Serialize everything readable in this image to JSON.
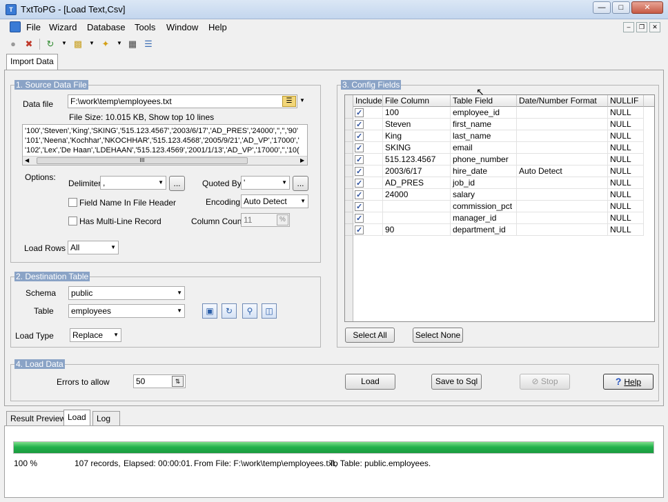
{
  "window": {
    "title": "TxtToPG - [Load Text,Csv]",
    "minimize": "0",
    "maximize": "1",
    "close": "r"
  },
  "menu": [
    "File",
    "Wizard",
    "Database",
    "Tools",
    "Window",
    "Help"
  ],
  "tabs_top": [
    "Import Data"
  ],
  "source": {
    "group_title": "1. Source Data File",
    "data_file_label": "Data file",
    "data_file_value": "F:\\work\\temp\\employees.txt",
    "file_info": "File Size: 10.015 KB,  Show top 10 lines",
    "preview_lines": [
      "'100','Steven','King','SKING','515.123.4567','2003/6/17','AD_PRES','24000','','','90'",
      "'101','Neena','Kochhar','NKOCHHAR','515.123.4568','2005/9/21','AD_VP','17000','",
      "'102','Lex','De Haan','LDEHAAN','515.123.4569','2001/1/13','AD_VP','17000','','10("
    ],
    "scroll_mark": "III",
    "options_label": "Options:",
    "delimiter_label": "Delimiter",
    "delimiter_value": ",",
    "quoted_by_label": "Quoted By",
    "quoted_by_value": "'",
    "browse_label": "...",
    "field_name_header_label": "Field Name In File Header",
    "multiline_label": "Has Multi-Line Record",
    "encoding_label": "Encoding",
    "encoding_value": "Auto Detect",
    "column_count_label": "Column Count",
    "column_count_value": "11",
    "load_rows_label": "Load Rows",
    "load_rows_value": "All"
  },
  "destination": {
    "group_title": "2. Destination Table",
    "schema_label": "Schema",
    "schema_value": "public",
    "table_label": "Table",
    "table_value": "employees",
    "load_type_label": "Load Type",
    "load_type_value": "Replace"
  },
  "config": {
    "group_title": "3. Config Fields",
    "columns": [
      "Include",
      "File Column",
      "Table Field",
      "Date/Number Format",
      "NULLIF"
    ],
    "rows": [
      {
        "include": true,
        "file_column": "100",
        "table_field": "employee_id",
        "format": "",
        "nullif": "NULL"
      },
      {
        "include": true,
        "file_column": "Steven",
        "table_field": "first_name",
        "format": "",
        "nullif": "NULL"
      },
      {
        "include": true,
        "file_column": "King",
        "table_field": "last_name",
        "format": "",
        "nullif": "NULL"
      },
      {
        "include": true,
        "file_column": "SKING",
        "table_field": "email",
        "format": "",
        "nullif": "NULL"
      },
      {
        "include": true,
        "file_column": "515.123.4567",
        "table_field": "phone_number",
        "format": "",
        "nullif": "NULL"
      },
      {
        "include": true,
        "file_column": "2003/6/17",
        "table_field": "hire_date",
        "format": "Auto Detect",
        "nullif": "NULL"
      },
      {
        "include": true,
        "file_column": "AD_PRES",
        "table_field": "job_id",
        "format": "",
        "nullif": "NULL"
      },
      {
        "include": true,
        "file_column": "24000",
        "table_field": "salary",
        "format": "",
        "nullif": "NULL"
      },
      {
        "include": true,
        "file_column": "",
        "table_field": "commission_pct",
        "format": "",
        "nullif": "NULL"
      },
      {
        "include": true,
        "file_column": "",
        "table_field": "manager_id",
        "format": "",
        "nullif": "NULL"
      },
      {
        "include": true,
        "file_column": "90",
        "table_field": "department_id",
        "format": "",
        "nullif": "NULL"
      }
    ],
    "select_all": "Select All",
    "select_none": "Select None"
  },
  "load": {
    "group_title": "4. Load Data",
    "errors_label": "Errors to allow",
    "errors_value": "50",
    "load_button": "Load",
    "save_sql_button": "Save to Sql",
    "stop_button": "Stop",
    "help_button": "Help"
  },
  "tabs_bottom": [
    "Result Preview",
    "Load",
    "Log"
  ],
  "status": {
    "progress": 1.0,
    "percent": "100 %",
    "records": "107 records,",
    "elapsed": "Elapsed: 00:00:01.",
    "from_file": "From File: F:\\work\\temp\\employees.txt,",
    "to_table": "To Table: public.employees."
  },
  "colors": {
    "progress": "#22b14c",
    "group_title_bg": "#8aa3c6"
  }
}
